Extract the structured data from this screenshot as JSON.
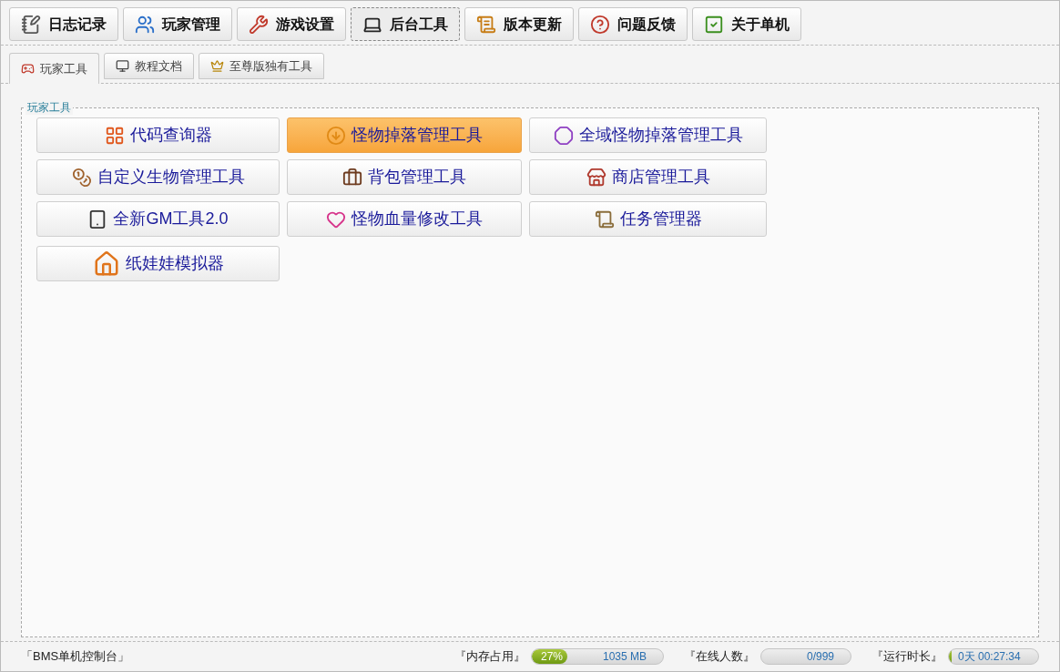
{
  "main_tabs": [
    {
      "label": "日志记录",
      "selected": false
    },
    {
      "label": "玩家管理",
      "selected": false
    },
    {
      "label": "游戏设置",
      "selected": false
    },
    {
      "label": "后台工具",
      "selected": true
    },
    {
      "label": "版本更新",
      "selected": false
    },
    {
      "label": "问题反馈",
      "selected": false
    },
    {
      "label": "关于单机",
      "selected": false
    }
  ],
  "sub_tabs": [
    {
      "label": "玩家工具",
      "selected": true
    },
    {
      "label": "教程文档",
      "selected": false
    },
    {
      "label": "至尊版独有工具",
      "selected": false
    }
  ],
  "group": {
    "title": "玩家工具",
    "tools": [
      {
        "label": "代码查询器",
        "highlighted": false
      },
      {
        "label": "怪物掉落管理工具",
        "highlighted": true
      },
      {
        "label": "全域怪物掉落管理工具",
        "highlighted": false
      },
      {
        "label": "自定义生物管理工具",
        "highlighted": false
      },
      {
        "label": "背包管理工具",
        "highlighted": false
      },
      {
        "label": "商店管理工具",
        "highlighted": false
      },
      {
        "label": "全新GM工具2.0",
        "highlighted": false
      },
      {
        "label": "怪物血量修改工具",
        "highlighted": false
      },
      {
        "label": "任务管理器",
        "highlighted": false
      },
      {
        "label": "纸娃娃模拟器",
        "highlighted": false
      }
    ]
  },
  "status_bar": {
    "app_name": "「BMS单机控制台」",
    "meters": [
      {
        "label": "『内存占用』",
        "level": 0.27,
        "percent": "27%",
        "reading": "1035 MB"
      },
      {
        "label": "『在线人数』",
        "reading": "0/999"
      },
      {
        "label": "『运行时长』",
        "level": 0.03,
        "reading": "0天 00:27:34"
      }
    ]
  }
}
